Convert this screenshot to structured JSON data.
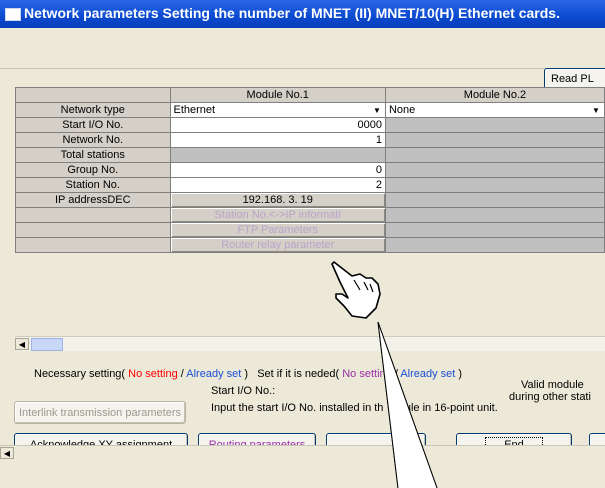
{
  "window": {
    "title": "Network parameters  Setting the number of MNET (II) MNET/10(H) Ethernet cards."
  },
  "toolbar": {
    "read_plc_label": "Read PL"
  },
  "table": {
    "columns": [
      "Module No.1",
      "Module No.2"
    ],
    "rows": {
      "network_type": {
        "label": "Network type",
        "m1": "Ethernet",
        "m2": "None"
      },
      "start_io": {
        "label": "Start I/O No.",
        "m1": "0000"
      },
      "network_no": {
        "label": "Network No.",
        "m1": "1"
      },
      "total_stations": {
        "label": "Total stations"
      },
      "group_no": {
        "label": "Group No.",
        "m1": "0"
      },
      "station_no": {
        "label": "Station No.",
        "m1": "2"
      },
      "ip_address": {
        "label": "IP addressDEC",
        "m1": "192.168.  3. 19"
      },
      "station_ip": {
        "m1": "Station No.<->IP informati"
      },
      "ftp": {
        "m1": "FTP Parameters"
      },
      "router": {
        "m1": "Router relay parameter"
      }
    }
  },
  "legend": {
    "necessary_label": "Necessary setting(",
    "necessary_no": "No setting",
    "slash1": "/",
    "necessary_set": "Already set",
    "close1": ")",
    "needed_label": "Set if it is ne",
    "needed_label2": "ded(",
    "needed_no": "No setting",
    "slash2": "/",
    "needed_set": "Already set",
    "close2": ")"
  },
  "info": {
    "start_io_heading": "Start I/O No.:",
    "start_io_text1": "Input the start I/O No. installed in th",
    "start_io_text2": "odule in 16-point unit.",
    "valid_module1": "Valid module",
    "valid_module2": "during other stati"
  },
  "buttons": {
    "interlink": "Interlink transmission parameters",
    "ack_xy": "Acknowledge XY assignment",
    "routing": "Routing parameters",
    "check": "Chec",
    "end": "End"
  },
  "colors": {
    "title_bar": "#0b4ad0",
    "no_setting": "#ff0000",
    "already_set": "#1a4fd6",
    "optional": "#9a2fa8"
  },
  "icons": {
    "cursor": "hand-pointer-icon"
  }
}
